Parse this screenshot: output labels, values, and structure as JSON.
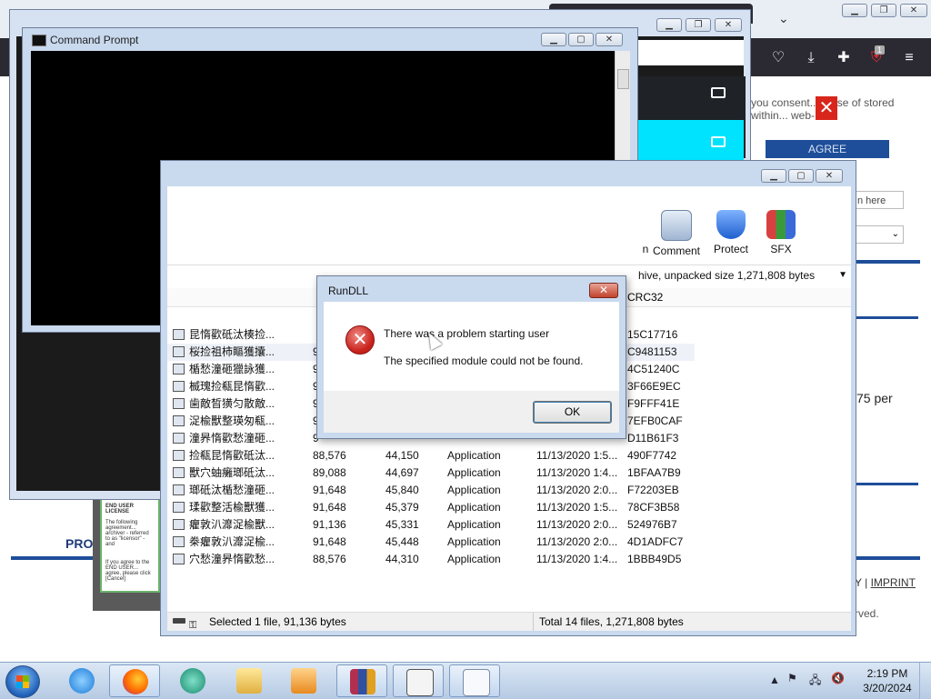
{
  "colors": {
    "browser_toolbar": "#2b2a33",
    "accent_blue": "#1e4e9a",
    "cyan_row": "#00e3ff",
    "error_red": "#c8211b"
  },
  "browser": {
    "consent_text": "you consent... e use of stored within... web-",
    "agree_label": "AGREE",
    "login_placeholder": "n here",
    "price_text": "75 per",
    "imprint_sep": "Y | ",
    "imprint_label": "IMPRINT",
    "served_text": "rved.",
    "pro_label": "PRO",
    "eula_heading": "END USER LICENSE",
    "eula_text": "The following agreement... archiver - referred to as \"licensor\" - and",
    "eula_footer": "If you agree to the END USER... agree, please click [Cancel]",
    "toolbar_badge": "1"
  },
  "cmd": {
    "title": "Command Prompt"
  },
  "winrar": {
    "tools": [
      {
        "label": "n",
        "icon": "wizard-icon"
      },
      {
        "label": "Comment",
        "icon": "comment-icon"
      },
      {
        "label": "Protect",
        "icon": "shield-icon"
      },
      {
        "label": "SFX",
        "icon": "sfx-icon"
      }
    ],
    "path_text": "hive, unpacked size 1,271,808 bytes",
    "crc_header": "CRC32",
    "rows": [
      {
        "name": "昆惰歡砥汰楱捡...",
        "size": "",
        "packed": "",
        "type": "",
        "modified": "",
        "crc": "15C17716"
      },
      {
        "name": "桜捡祖柿瞘獲攮...",
        "size": "9",
        "packed": "",
        "type": "",
        "modified": "",
        "crc": "C9481153"
      },
      {
        "name": "楯愁潼砸獵詠獲...",
        "size": "9",
        "packed": "",
        "type": "",
        "modified": "",
        "crc": "4C51240C"
      },
      {
        "name": "楲瑰捡瓻昆惰歡...",
        "size": "9",
        "packed": "",
        "type": "",
        "modified": "",
        "crc": "3F66E9EC"
      },
      {
        "name": "歯敵晳獚匀散敵...",
        "size": "9",
        "packed": "",
        "type": "",
        "modified": "",
        "crc": "F9FFF41E"
      },
      {
        "name": "浞楡獸整瑛匆瓻...",
        "size": "9",
        "packed": "",
        "type": "",
        "modified": "",
        "crc": "7EFB0CAF"
      },
      {
        "name": "潼昦惰歡愁潼砸...",
        "size": "9",
        "packed": "",
        "type": "",
        "modified": "",
        "crc": "D11B61F3"
      },
      {
        "name": "捡瓻昆惰歡砥汰...",
        "size": "88,576",
        "packed": "44,150",
        "type": "Application",
        "modified": "11/13/2020 1:5...",
        "crc": "490F7742"
      },
      {
        "name": "獸穴蚰癱瑯砥汰...",
        "size": "89,088",
        "packed": "44,697",
        "type": "Application",
        "modified": "11/13/2020 1:4...",
        "crc": "1BFAA7B9"
      },
      {
        "name": "瑯砥汰楯愁潼砸...",
        "size": "91,648",
        "packed": "45,840",
        "type": "Application",
        "modified": "11/13/2020 2:0...",
        "crc": "F72203EB"
      },
      {
        "name": "瑈歡整活楡獸獲...",
        "size": "91,648",
        "packed": "45,379",
        "type": "Application",
        "modified": "11/13/2020 1:5...",
        "crc": "78CF3B58"
      },
      {
        "name": "癯敦汃灖浞楡獸...",
        "size": "91,136",
        "packed": "45,331",
        "type": "Application",
        "modified": "11/13/2020 2:0...",
        "crc": "524976B7"
      },
      {
        "name": "桊癯敦汃灖浞楡...",
        "size": "91,648",
        "packed": "45,448",
        "type": "Application",
        "modified": "11/13/2020 2:0...",
        "crc": "4D1ADFC7"
      },
      {
        "name": "穴愁潼昦惰歡愁...",
        "size": "88,576",
        "packed": "44,310",
        "type": "Application",
        "modified": "11/13/2020 1:4...",
        "crc": "1BBB49D5"
      }
    ],
    "status_left": "Selected 1 file, 91,136 bytes",
    "status_right": "Total 14 files, 1,271,808 bytes"
  },
  "dialog": {
    "title": "RunDLL",
    "close_label": "✕",
    "message": "There was a problem starting user",
    "detail": "The specified module could not be found.",
    "ok_label": "OK",
    "icon": "error-icon"
  },
  "taskbar": {
    "apps": [
      "internet-explorer-icon",
      "firefox-icon",
      "media-icon",
      "explorer-icon",
      "media-player-icon",
      "winrar-icon",
      "cmd-icon",
      "document-icon"
    ],
    "time": "2:19 PM",
    "date": "3/20/2024"
  }
}
